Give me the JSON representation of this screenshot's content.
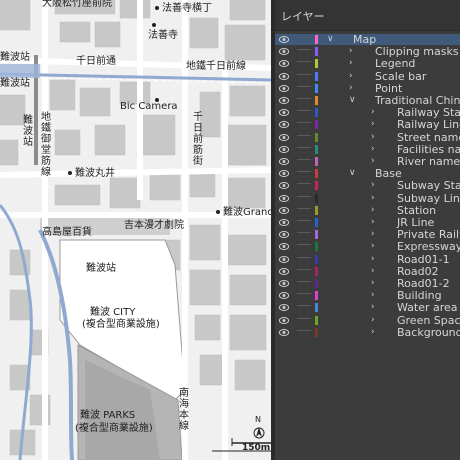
{
  "panel": {
    "tab_label": "レイヤー",
    "layers": [
      {
        "label": "Map",
        "depth": 0,
        "arrow": "down",
        "color": "#ff66cc",
        "selected": true
      },
      {
        "label": "Clipping masks",
        "depth": 1,
        "arrow": "right",
        "color": "#8a5cff"
      },
      {
        "label": "Legend",
        "depth": 1,
        "arrow": "right",
        "color": "#b0c833"
      },
      {
        "label": "Scale bar",
        "depth": 1,
        "arrow": "right",
        "color": "#5577ff"
      },
      {
        "label": "Point",
        "depth": 1,
        "arrow": "right",
        "color": "#4488ff"
      },
      {
        "label": "Traditional Chinese",
        "depth": 1,
        "arrow": "down",
        "color": "#e08a2a"
      },
      {
        "label": "Railway Station",
        "depth": 2,
        "arrow": "right",
        "color": "#3355cc"
      },
      {
        "label": "Railway Line",
        "depth": 2,
        "arrow": "right",
        "color": "#7a2aa0"
      },
      {
        "label": "Street name",
        "depth": 2,
        "arrow": "right",
        "color": "#6a8a2a"
      },
      {
        "label": "Facilities name",
        "depth": 2,
        "arrow": "right",
        "color": "#2a8a8a"
      },
      {
        "label": "River name",
        "depth": 2,
        "arrow": "right",
        "color": "#bb66bb"
      },
      {
        "label": "Base",
        "depth": 1,
        "arrow": "down",
        "color": "#cc3a3a"
      },
      {
        "label": "Subway Station",
        "depth": 2,
        "arrow": "right",
        "color": "#cc2255"
      },
      {
        "label": "Subway Line",
        "depth": 2,
        "arrow": "right",
        "color": "#2a2a2a"
      },
      {
        "label": "Station",
        "depth": 2,
        "arrow": "right",
        "color": "#9a9a2a"
      },
      {
        "label": "JR Line",
        "depth": 2,
        "arrow": "right",
        "color": "#2266cc"
      },
      {
        "label": "Private Railway",
        "depth": 2,
        "arrow": "right",
        "color": "#aa66dd"
      },
      {
        "label": "Expressway",
        "depth": 2,
        "arrow": "right",
        "color": "#1a7a3a"
      },
      {
        "label": "Road01-1",
        "depth": 2,
        "arrow": "right",
        "color": "#3a3aaa"
      },
      {
        "label": "Road02",
        "depth": 2,
        "arrow": "right",
        "color": "#aa2266"
      },
      {
        "label": "Road01-2",
        "depth": 2,
        "arrow": "right",
        "color": "#5a2a8a"
      },
      {
        "label": "Building",
        "depth": 2,
        "arrow": "right",
        "color": "#dd44cc"
      },
      {
        "label": "Water area",
        "depth": 2,
        "arrow": "right",
        "color": "#4488dd"
      },
      {
        "label": "Green Space",
        "depth": 2,
        "arrow": "right",
        "color": "#66aa22"
      },
      {
        "label": "Background",
        "depth": 2,
        "arrow": "right",
        "color": "#7a3a2a"
      }
    ]
  },
  "map": {
    "labels": {
      "top_street": "大阪松竹座前院",
      "hozenji_yokocho": "法善寺横丁",
      "hozenji": "法善寺",
      "namba_station_tl": "難波站",
      "sennichi_mae_dori": "千日前通",
      "chikatetsu_sennichimae_sen": "地鐵千日前線",
      "namba_station_left": "難波站",
      "namba_v": "難波站",
      "chikatetsu_midosuji": "地鐵御堂筋線",
      "bic_camera": "Bic Camera",
      "sennichimae_suji": "千日前筋街",
      "namba_marui": "難波丸井",
      "namba_grand": "難波Grand",
      "takashimaya": "高島屋百貨",
      "yoshimoto": "吉本漫才劇院",
      "namba_station_center": "難波站",
      "namba_city": "難波 CITY",
      "namba_city_sub": "(複合型商業設施)",
      "namba_parks": "難波 PARKS",
      "namba_parks_sub": "(複合型商業設施)",
      "nankai_honsen": "南海本線",
      "north_symbol": "N",
      "scale_label": "150m"
    }
  }
}
